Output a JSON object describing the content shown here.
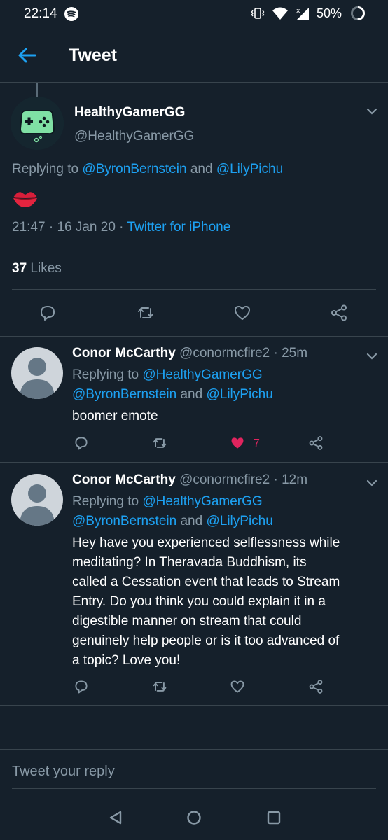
{
  "status_bar": {
    "time": "22:14",
    "battery_text": "50%",
    "icons": [
      "spotify-icon",
      "vibrate-icon",
      "wifi-icon",
      "signal-icon",
      "battery-icon"
    ]
  },
  "header": {
    "title": "Tweet",
    "back_icon": "arrow-left-icon"
  },
  "main_tweet": {
    "name": "HealthyGamerGG",
    "handle": "@HealthyGamerGG",
    "replying_prefix": "Replying to ",
    "replying_user1": "@ByronBernstein",
    "replying_and": " and ",
    "replying_user2": "@LilyPichu",
    "content_emoji": "kiss-mark-icon",
    "time": "21:47",
    "date": "16 Jan 20",
    "sep": " · ",
    "client": "Twitter for iPhone",
    "likes_count": "37",
    "likes_label": "Likes"
  },
  "replies": [
    {
      "name": "Conor McCarthy",
      "handle": "@conormcfire2",
      "age": "25m",
      "replying_prefix": "Replying to ",
      "replying_user1": "@HealthyGamerGG",
      "replying_user2": "@ByronBernstein",
      "replying_and": " and ",
      "replying_user3": "@LilyPichu",
      "text": "boomer emote",
      "like_count": "7"
    },
    {
      "name": "Conor McCarthy",
      "handle": "@conormcfire2",
      "age": "12m",
      "replying_prefix": "Replying to ",
      "replying_user1": "@HealthyGamerGG",
      "replying_user2": "@ByronBernstein",
      "replying_and": " and ",
      "replying_user3": "@LilyPichu",
      "text_lines": [
        "Hey have you experienced selflessness while",
        "meditating? In Theravada Buddhism, its",
        "called a Cessation event that leads to Stream",
        "Entry. Do you think you could explain it in a",
        "digestible manner on stream that could",
        "genuinely help people or is it too advanced of",
        "a topic? Love you!"
      ]
    }
  ],
  "reply_bar": {
    "placeholder": "Tweet your reply"
  },
  "colors": {
    "background": "#15202b",
    "accent": "#1da1f2",
    "secondary_text": "#8899a6",
    "like": "#e0245e",
    "divider": "#38444d"
  }
}
